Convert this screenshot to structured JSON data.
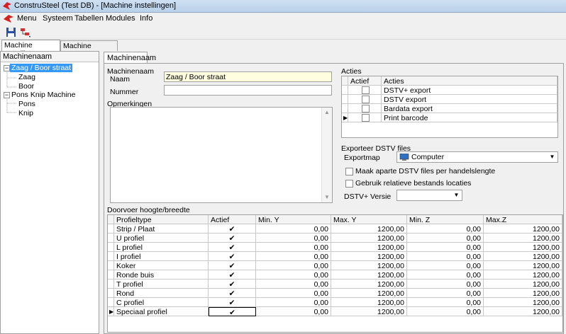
{
  "window": {
    "title": "ConstruSteel (Test DB) - [Machine instellingen]"
  },
  "menu": [
    "Menu",
    "Systeem",
    "Tabellen",
    "Modules",
    "Info"
  ],
  "outer_tabs": [
    "Machine Instellingen",
    "Machine voorkeur"
  ],
  "tree": {
    "header": "Machinenaam",
    "nodes": [
      {
        "label": "Zaag / Boor straat",
        "expander": "−"
      },
      {
        "label": "Zaag"
      },
      {
        "label": "Boor"
      },
      {
        "label": "Pons Knip Machine",
        "expander": "−"
      },
      {
        "label": "Pons"
      },
      {
        "label": "Knip"
      }
    ]
  },
  "inner_tab": "Machinenaam",
  "machinenaam": {
    "group": "Machinenaam",
    "naam_label": "Naam",
    "naam_value": "Zaag / Boor straat",
    "nummer_label": "Nummer",
    "nummer_value": ""
  },
  "opmerkingen": {
    "label": "Opmerkingen",
    "value": ""
  },
  "acties": {
    "group": "Acties",
    "columns": [
      "Actief",
      "Acties"
    ],
    "rows": [
      "DSTV+ export",
      "DSTV export",
      "Bardata export",
      "Print barcode"
    ]
  },
  "export": {
    "group": "Exporteer DSTV files",
    "exportmap_label": "Exportmap",
    "exportmap_value": "Computer",
    "check1": "Maak aparte DSTV files per handelslengte",
    "check2": "Gebruik relatieve bestands locaties",
    "versie_label": "DSTV+ Versie",
    "versie_value": ""
  },
  "doorvoer": {
    "group": "Doorvoer hoogte/breedte",
    "columns": [
      "Profieltype",
      "Actief",
      "Min. Y",
      "Max. Y",
      "Min. Z",
      "Max.Z"
    ],
    "rows": [
      {
        "type": "Strip / Plaat",
        "actief": "✔",
        "min_y": "0,00",
        "max_y": "1200,00",
        "min_z": "0,00",
        "max_z": "1200,00"
      },
      {
        "type": "U profiel",
        "actief": "✔",
        "min_y": "0,00",
        "max_y": "1200,00",
        "min_z": "0,00",
        "max_z": "1200,00"
      },
      {
        "type": "L profiel",
        "actief": "✔",
        "min_y": "0,00",
        "max_y": "1200,00",
        "min_z": "0,00",
        "max_z": "1200,00"
      },
      {
        "type": "I profiel",
        "actief": "✔",
        "min_y": "0,00",
        "max_y": "1200,00",
        "min_z": "0,00",
        "max_z": "1200,00"
      },
      {
        "type": "Koker",
        "actief": "✔",
        "min_y": "0,00",
        "max_y": "1200,00",
        "min_z": "0,00",
        "max_z": "1200,00"
      },
      {
        "type": "Ronde buis",
        "actief": "✔",
        "min_y": "0,00",
        "max_y": "1200,00",
        "min_z": "0,00",
        "max_z": "1200,00"
      },
      {
        "type": "T profiel",
        "actief": "✔",
        "min_y": "0,00",
        "max_y": "1200,00",
        "min_z": "0,00",
        "max_z": "1200,00"
      },
      {
        "type": "Rond",
        "actief": "✔",
        "min_y": "0,00",
        "max_y": "1200,00",
        "min_z": "0,00",
        "max_z": "1200,00"
      },
      {
        "type": "C profiel",
        "actief": "✔",
        "min_y": "0,00",
        "max_y": "1200,00",
        "min_z": "0,00",
        "max_z": "1200,00"
      },
      {
        "type": "Speciaal profiel",
        "actief": "✔",
        "min_y": "0,00",
        "max_y": "1200,00",
        "min_z": "0,00",
        "max_z": "1200,00"
      }
    ]
  },
  "icons": {
    "logo": "construsteel-logo-icon",
    "save": "save-icon",
    "tree": "tree-structure-icon",
    "computer": "computer-icon"
  },
  "colors": {
    "selection": "#3399ff",
    "name_field": "#ffffe0"
  }
}
